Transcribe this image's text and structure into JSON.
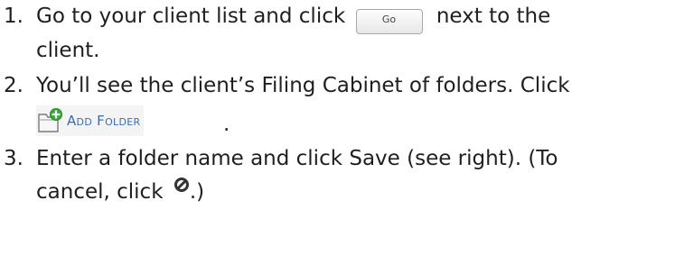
{
  "steps": [
    {
      "number": "1.",
      "before": "Go to your client list and click",
      "button_label": "Go",
      "after": "next to the",
      "continuation": "client."
    },
    {
      "number": "2.",
      "text": "You’ll see the client’s Filing Cabinet of folders. Click",
      "button_label": "Add Folder",
      "after": "."
    },
    {
      "number": "3.",
      "text": "Enter a folder name and click Save (see right). (To",
      "continuation_before": "cancel, click",
      "continuation_after": ".)"
    }
  ],
  "colors": {
    "text": "#1f1f1f",
    "link_blue": "#3b6cb7",
    "folder_green": "#3aa83a"
  },
  "icons": {
    "folder_add": "folder-add-icon",
    "cancel": "cancel-icon"
  }
}
